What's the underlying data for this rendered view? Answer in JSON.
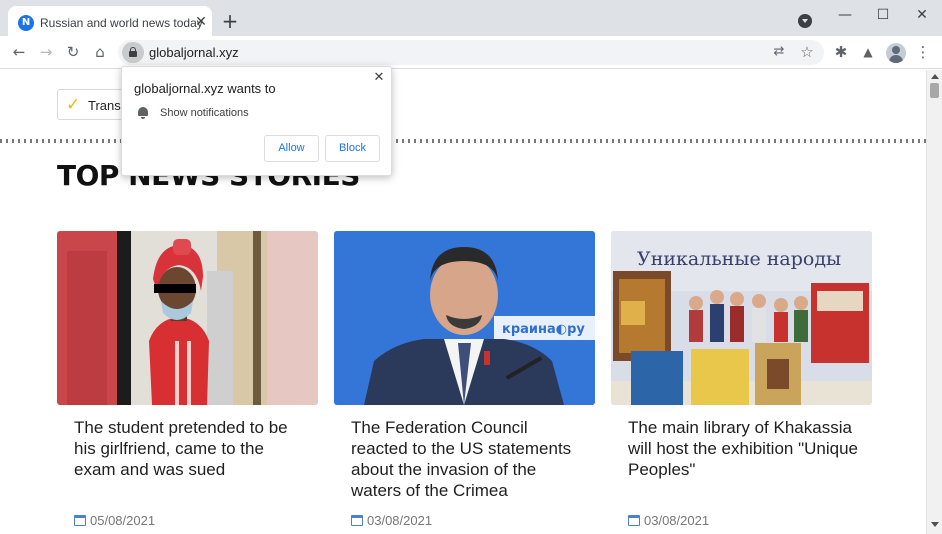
{
  "browser": {
    "tab": {
      "favicon": "N",
      "title": "Russian and world news today",
      "close": "✕"
    },
    "new_tab": "+",
    "window": {
      "minimize": "—",
      "maximize": "☐",
      "close": "✕"
    },
    "url": "globaljornal.xyz",
    "icons": {
      "back": "←",
      "forward": "→",
      "reload": "↻",
      "home": "⌂",
      "translate": "⇄",
      "star": "☆",
      "extensions": "✱",
      "labs": "▲",
      "menu": "⋮"
    }
  },
  "permission_popup": {
    "title": "globaljornal.xyz wants to",
    "request": "Show notifications",
    "allow": "Allow",
    "block": "Block",
    "close": "✕"
  },
  "page": {
    "translate_label": "Transl",
    "section_title": "TOP NEWS STORIES",
    "articles": [
      {
        "title": "The student pretended to be his girlfriend, came to the exam and was sued",
        "date": "05/08/2021"
      },
      {
        "title": "The Federation Council reacted to the US statements about the invasion of the waters of the Crimea",
        "date": "03/08/2021"
      },
      {
        "title": "The main library of Khakassia will host the exhibition \"Unique Peoples\"",
        "date": "03/08/2021",
        "image_text": "Уникальные народы"
      }
    ]
  },
  "colors": {
    "accent": "#1a73e8",
    "check": "#f2b705",
    "calendar": "#4a7fd4"
  }
}
